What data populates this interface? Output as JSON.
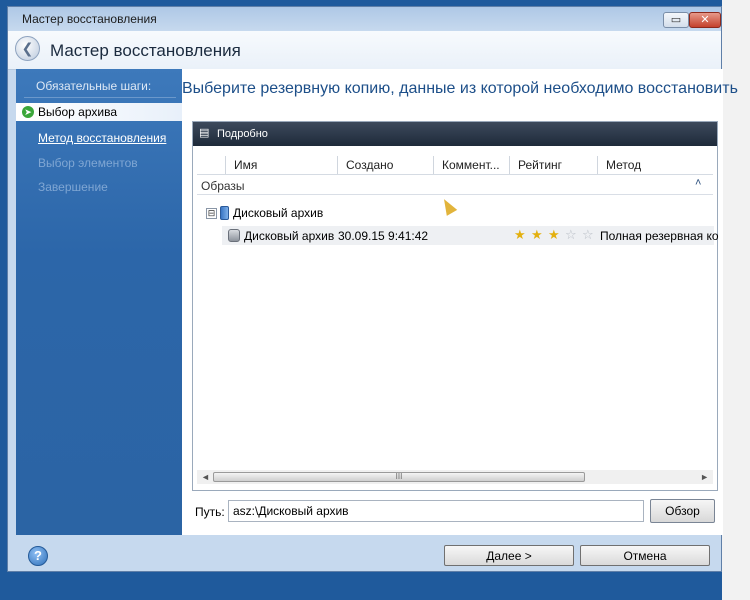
{
  "window": {
    "title": "Мастер восстановления",
    "restore_glyph": "▭",
    "close_glyph": "✕"
  },
  "header": {
    "title": "Мастер восстановления"
  },
  "sidebar": {
    "title": "Обязательные шаги:",
    "steps": [
      {
        "label": "Выбор архива",
        "state": "active"
      },
      {
        "label": "Метод восстановления",
        "state": "link"
      },
      {
        "label": "Выбор элементов",
        "state": "disabled"
      },
      {
        "label": "Завершение",
        "state": "disabled"
      }
    ]
  },
  "main": {
    "heading": "Выберите резервную копию, данные из которой необходимо восстановить",
    "panel": {
      "title": "Подробно",
      "columns": [
        "Имя",
        "Создано",
        "Коммент...",
        "Рейтинг",
        "Метод"
      ],
      "group": {
        "label": "Образы",
        "collapse_glyph": "˄"
      },
      "archive": {
        "expander": "⊟",
        "name": "Дисковый архив"
      },
      "backup": {
        "name": "Дисковый архив",
        "created": "30.09.15 9:41:42",
        "rating": 3,
        "rating_max": 5,
        "method": "Полная резервная ко"
      },
      "scrollbar": {
        "left": "◄",
        "right": "►",
        "grip": "III"
      }
    },
    "path": {
      "label": "Путь:",
      "value": "asz:\\Дисковый архив",
      "browse": "Обзор"
    }
  },
  "footer": {
    "help": "?",
    "next": "Далее >",
    "cancel": "Отмена"
  },
  "colors": {
    "sidebar": "#2c66a9",
    "accent": "#1d4f89",
    "panel_header": "#1e2a3a"
  }
}
